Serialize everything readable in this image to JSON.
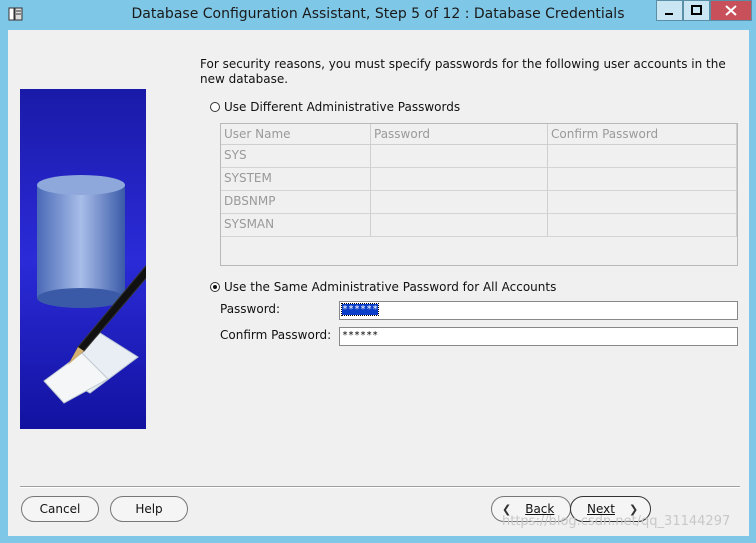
{
  "window": {
    "title": "Database Configuration Assistant, Step 5 of 12 : Database Credentials"
  },
  "content": {
    "intro": "For security reasons, you must specify passwords for the following user accounts in the new database.",
    "option_different": "Use Different Administrative Passwords",
    "option_same": "Use the Same Administrative Password for All Accounts",
    "selected_option": "same",
    "grid": {
      "columns": [
        "User Name",
        "Password",
        "Confirm Password"
      ],
      "rows": [
        "SYS",
        "SYSTEM",
        "DBSNMP",
        "SYSMAN"
      ]
    },
    "password_label": "Password:",
    "password_value": "******",
    "confirm_label": "Confirm Password:",
    "confirm_value": "******"
  },
  "buttons": {
    "cancel": "Cancel",
    "help": "Help",
    "back": "Back",
    "next": "Next"
  },
  "watermark": "https://blog.csdn.net/qq_31144297",
  "colors": {
    "titlebar": "#7fc7e6",
    "selection": "#0a3ec8",
    "panel": "#f0f0f0"
  },
  "icons": [
    "app-icon",
    "minimize-icon",
    "maximize-icon",
    "close-icon",
    "chevron-left-icon",
    "chevron-right-icon",
    "database-pen-illustration"
  ]
}
